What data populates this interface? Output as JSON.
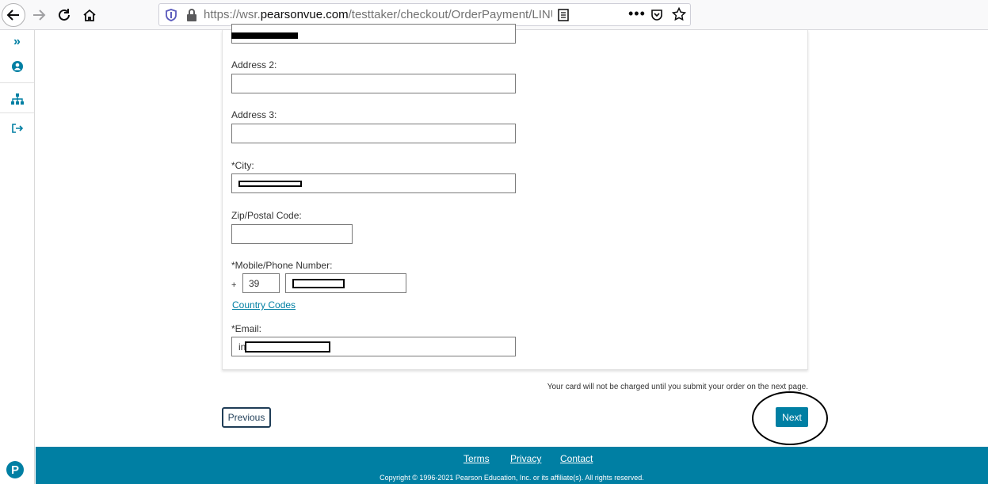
{
  "browser": {
    "url_host_prefix": "https://wsr.",
    "url_host_main": "pearsonvue.com",
    "url_path": "/testtaker/checkout/OrderPayment/LINUXPF",
    "more_label": "•••"
  },
  "rail": {
    "expand_icon": "»"
  },
  "form": {
    "address2_label": "Address 2:",
    "address3_label": "Address 3:",
    "city_label": "*City:",
    "zip_label": "Zip/Postal Code:",
    "phone_label": "*Mobile/Phone Number:",
    "phone_plus": "+",
    "country_code_value": "39",
    "country_codes_link": "Country Codes",
    "email_label": "*Email:",
    "email_visible_prefix": "in"
  },
  "notice": "Your card will not be charged until you submit your order on the next page.",
  "buttons": {
    "previous": "Previous",
    "next": "Next"
  },
  "footer": {
    "terms": "Terms",
    "privacy": "Privacy",
    "contact": "Contact",
    "copyright": "Copyright © 1996-2021 Pearson Education, Inc. or its affiliate(s). All rights reserved."
  }
}
